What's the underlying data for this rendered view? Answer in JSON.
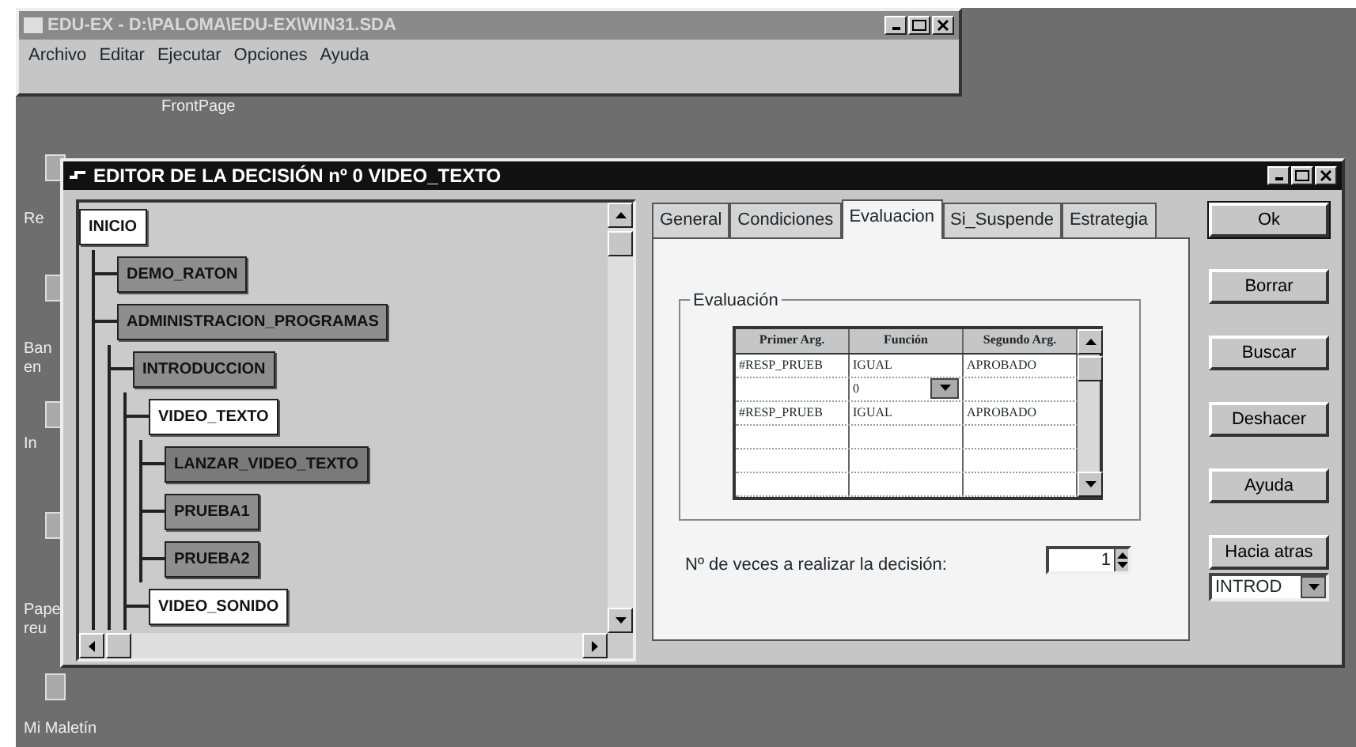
{
  "app_window": {
    "title": "EDU-EX - D:\\PALOMA\\EDU-EX\\WIN31.SDA",
    "menu": [
      "Archivo",
      "Editar",
      "Ejecutar",
      "Opciones",
      "Ayuda"
    ]
  },
  "desktop_icons": [
    {
      "lines": [
        "FrontPage"
      ]
    },
    {
      "lines": [
        "Re"
      ]
    },
    {
      "lines": [
        "Ban",
        "en"
      ]
    },
    {
      "lines": [
        "In"
      ]
    },
    {
      "lines": [
        "Pape",
        "reu"
      ]
    },
    {
      "lines": [
        "Mi Maletín"
      ]
    }
  ],
  "editor": {
    "title": "EDITOR DE LA DECISIÓN nº 0 VIDEO_TEXTO",
    "tree": [
      {
        "label": "INICIO",
        "color": "#ffffff",
        "children": [
          {
            "label": "DEMO_RATON",
            "color": "#8e8e8e"
          },
          {
            "label": "ADMINISTRACION_PROGRAMAS",
            "color": "#8e8e8e",
            "children": [
              {
                "label": "INTRODUCCION",
                "color": "#8e8e8e",
                "children": [
                  {
                    "label": "VIDEO_TEXTO",
                    "color": "#ffffff",
                    "children": [
                      {
                        "label": "LANZAR_VIDEO_TEXTO",
                        "color": "#7a7a7a"
                      },
                      {
                        "label": "PRUEBA1",
                        "color": "#8e8e8e"
                      },
                      {
                        "label": "PRUEBA2",
                        "color": "#8e8e8e"
                      }
                    ]
                  },
                  {
                    "label": "VIDEO_SONIDO",
                    "color": "#ffffff"
                  }
                ]
              }
            ]
          }
        ]
      }
    ],
    "tabs": [
      {
        "label": "General",
        "selected": false
      },
      {
        "label": "Condiciones",
        "selected": false
      },
      {
        "label": "Evaluacion",
        "selected": true
      },
      {
        "label": "Si_Suspende",
        "selected": false
      },
      {
        "label": "Estrategia",
        "selected": false
      }
    ],
    "group_title": "Evaluación",
    "grid": {
      "columns": [
        "Primer Arg.",
        "Función",
        "Segundo Arg."
      ],
      "rows": [
        [
          {
            "text": "#RESP_PRUEB"
          },
          {
            "text": "IGUAL"
          },
          {
            "text": "APROBADO"
          }
        ],
        [
          {},
          {
            "text": "0",
            "kind": "dropdown"
          },
          {}
        ],
        [
          {
            "text": "#RESP_PRUEB"
          },
          {
            "text": "IGUAL"
          },
          {
            "text": "APROBADO"
          }
        ],
        [
          {},
          {},
          {}
        ],
        [
          {},
          {},
          {}
        ],
        [
          {},
          {},
          {}
        ]
      ]
    },
    "repeat_label": "Nº de veces a realizar la decisión:",
    "repeat_value": "1",
    "buttons": [
      {
        "label": "Ok",
        "default": true
      },
      {
        "label": "Borrar",
        "default": false
      },
      {
        "label": "Buscar",
        "default": false
      },
      {
        "label": "Deshacer",
        "default": false
      },
      {
        "label": "Ayuda",
        "default": false
      },
      {
        "label": "Hacia atras",
        "default": false
      }
    ],
    "back_combo": "INTROD"
  }
}
